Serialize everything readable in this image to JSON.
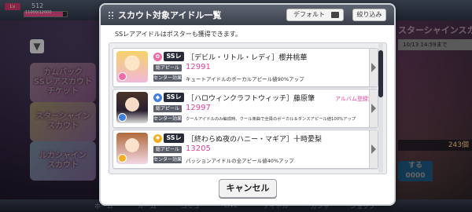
{
  "background": {
    "lv_label": "Lv",
    "lv_value": "512",
    "exp_text": "11000/12000",
    "exp_fraction": 0.9,
    "banners": [
      "カムバック\nSSレアスカウト\nチケット",
      "スターシャイン\nスカウト",
      "ルカシャイン\nスカウト"
    ],
    "right_title": "スターシャインスカウト",
    "right_date": "10/13 14:59まで",
    "right_count": "243個",
    "right_button": "する\n0000",
    "nav": [
      "ホーム",
      "ルーム",
      "コミュ",
      "LIVE",
      "アイドル",
      "ガシャ",
      "ショップ"
    ]
  },
  "modal": {
    "title": "スカウト対象アイドル一覧",
    "default_button": "デフォルト",
    "filter_button": "絞り込み",
    "note": "SSレアアイドルはポスターも獲得できます。",
    "appeal_tag": "総アピール",
    "center_tag": "センター効果",
    "cards": [
      {
        "type_color": "#f06aa8",
        "type_icon": "cute-icon",
        "type_glyph": "✿",
        "rarity": "SSレア",
        "name": "［デビル・リトル・レディ］櫻井桃華",
        "appeal": "12991",
        "center_effect": "キュートアイドルのボーカルアピール値90%アップ",
        "album_badge": ""
      },
      {
        "type_color": "#3f7fe0",
        "type_icon": "cool-icon",
        "type_glyph": "◆",
        "rarity": "SSレア",
        "name": "［ハロウィンクラフトウィッチ］藤原肇",
        "appeal": "12997",
        "center_effect": "クールアイドルのみ編成時、クール楽曲で全員のボーカル＆ダンスアピール値100%アップ",
        "album_badge": "アルバム登録済"
      },
      {
        "type_color": "#f2b01e",
        "type_icon": "passion-icon",
        "type_glyph": "✹",
        "rarity": "SSレア",
        "name": "［終わらぬ夜のハニー・マギア］十時愛梨",
        "appeal": "13205",
        "center_effect": "パッションアイドルの全アピール値40%アップ",
        "album_badge": ""
      }
    ],
    "cancel_button": "キャンセル"
  }
}
